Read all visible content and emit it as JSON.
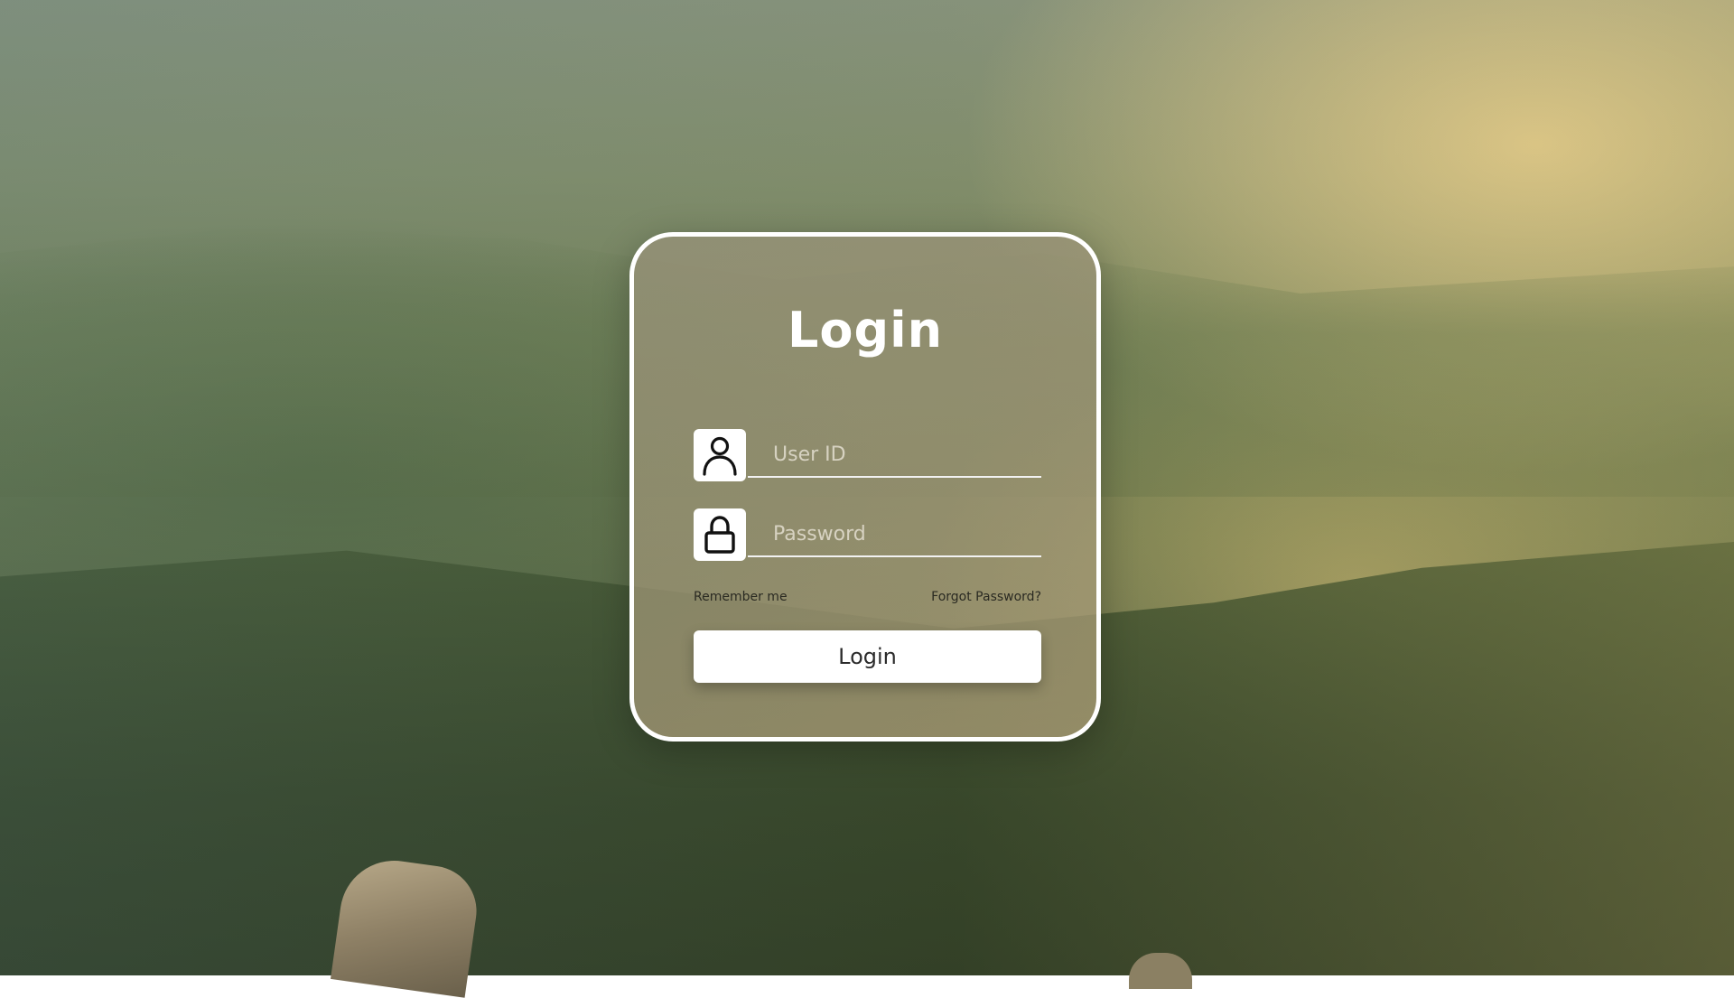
{
  "login_card": {
    "title": "Login",
    "user_id": {
      "placeholder": "User ID",
      "value": "",
      "icon": "user-icon"
    },
    "password": {
      "placeholder": "Password",
      "value": "",
      "icon": "lock-icon"
    },
    "remember_label": "Remember me",
    "forgot_label": "Forgot Password?",
    "submit_label": "Login"
  },
  "colors": {
    "card_border": "#ffffff",
    "title_text": "#ffffff",
    "button_bg": "#ffffff",
    "button_text": "#2b2b2b"
  }
}
